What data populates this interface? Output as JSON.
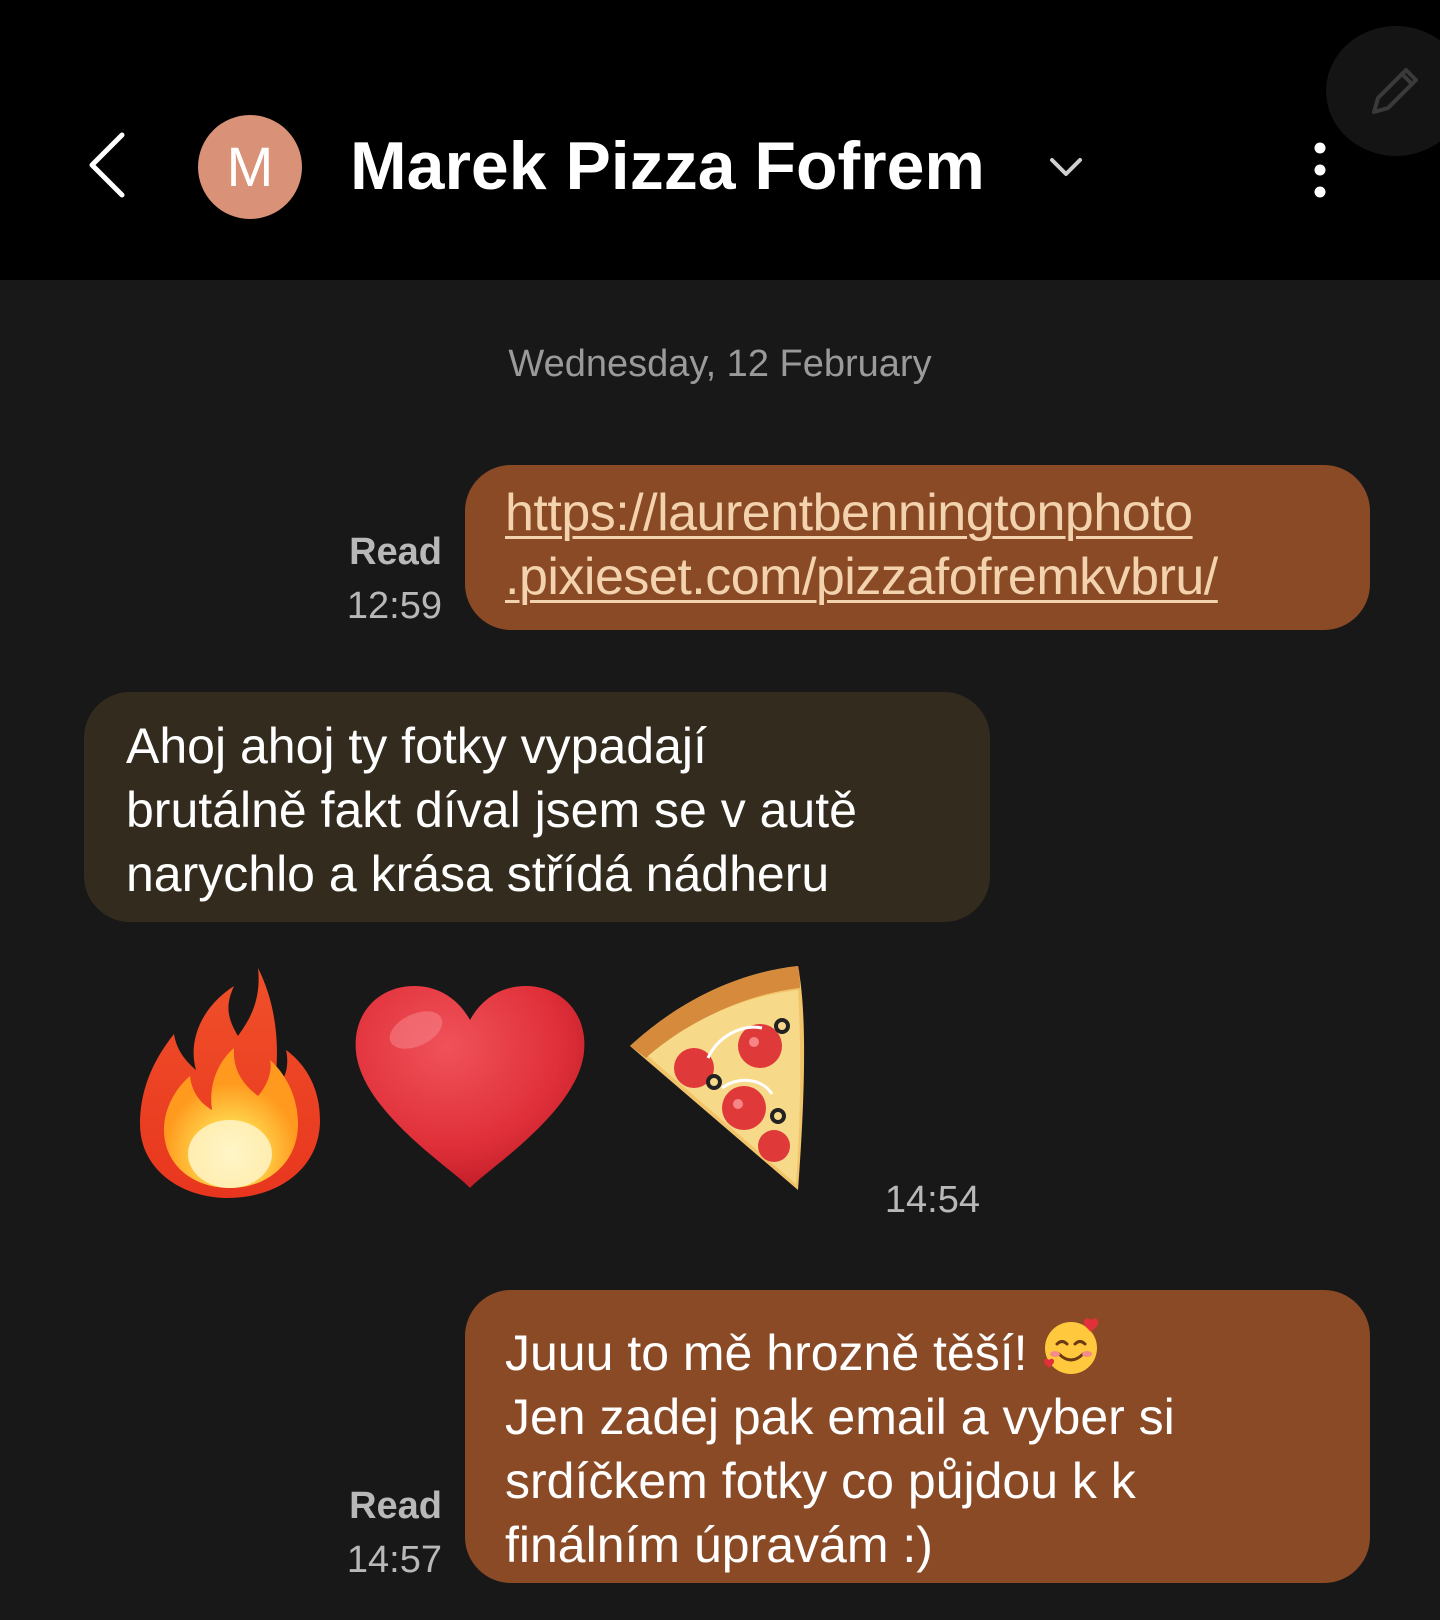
{
  "conversation": {
    "contact_name": "Marek Pizza Fofrem",
    "avatar_initial": "M",
    "avatar_color": "#D99277",
    "date_separator": "Wednesday, 12 February"
  },
  "messages": [
    {
      "direction": "sent",
      "text": "https://laurentbenningtonphoto\n.pixieset.com/pizzafofremkvbru/",
      "status": "Read",
      "time": "12:59"
    },
    {
      "direction": "received",
      "text": "Ahoj ahoj ty fotky vypadají\nbrutálně fakt díval jsem se v autě\nnarychlo a krása střídá nádheru"
    },
    {
      "direction": "received",
      "emojis": [
        "fire-emoji",
        "red-heart-emoji",
        "pizza-emoji"
      ],
      "time": "14:54"
    },
    {
      "direction": "sent",
      "text_line1": "Juuu to mě hrozně těší!",
      "text_rest": "Jen zadej pak email a vyber si\nsrdíčkem fotky co půjdou k k\nfinálním úpravám :)",
      "inline_emoji": "smiling-face-with-hearts-emoji",
      "status": "Read",
      "time": "14:57"
    }
  ],
  "colors": {
    "sent_bubble": "#8A4A26",
    "received_bubble": "#332C1E",
    "background": "#181818",
    "header": "#000000",
    "link": "#F3D3AE"
  }
}
